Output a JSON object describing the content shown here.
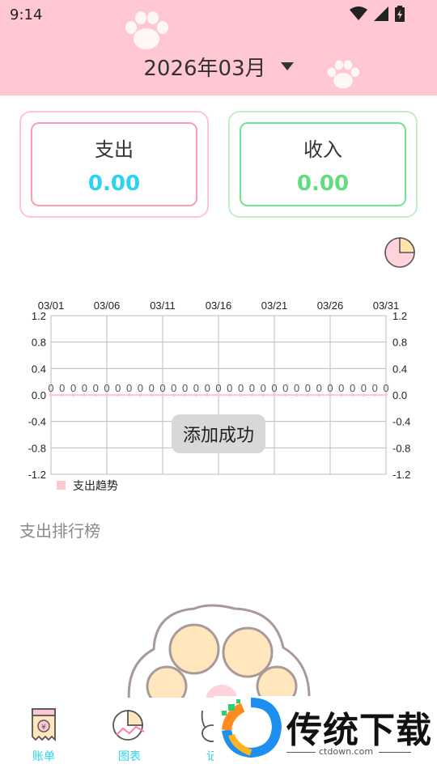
{
  "status_bar": {
    "time": "9:14"
  },
  "header": {
    "month": "2026年03月"
  },
  "summary": {
    "expense": {
      "label": "支出",
      "value": "0.00",
      "color": "#2ad3f2"
    },
    "income": {
      "label": "收入",
      "value": "0.00",
      "color": "#62dd7d"
    }
  },
  "chart_data": {
    "type": "line",
    "x_ticks": [
      "03/01",
      "03/06",
      "03/11",
      "03/16",
      "03/21",
      "03/26",
      "03/31"
    ],
    "x": [
      "03/01",
      "03/02",
      "03/03",
      "03/04",
      "03/05",
      "03/06",
      "03/07",
      "03/08",
      "03/09",
      "03/10",
      "03/11",
      "03/12",
      "03/13",
      "03/14",
      "03/15",
      "03/16",
      "03/17",
      "03/18",
      "03/19",
      "03/20",
      "03/21",
      "03/22",
      "03/23",
      "03/24",
      "03/25",
      "03/26",
      "03/27",
      "03/28",
      "03/29",
      "03/30",
      "03/31"
    ],
    "series": [
      {
        "name": "支出趋势",
        "values": [
          0,
          0,
          0,
          0,
          0,
          0,
          0,
          0,
          0,
          0,
          0,
          0,
          0,
          0,
          0,
          0,
          0,
          0,
          0,
          0,
          0,
          0,
          0,
          0,
          0,
          0,
          0,
          0,
          0,
          0,
          0
        ],
        "color": "#ffc7d2"
      }
    ],
    "value_labels": [
      "0",
      "0",
      "0",
      "0",
      "0",
      "0",
      "0",
      "0",
      "0",
      "0",
      "0",
      "0",
      "0",
      "0",
      "0",
      "0",
      "0",
      "0",
      "0",
      "0",
      "0",
      "0",
      "0",
      "0",
      "0",
      "0",
      "0",
      "0",
      "0",
      "0",
      "0"
    ],
    "y_ticks": [
      "1.2",
      "0.8",
      "0.4",
      "0.0",
      "-0.4",
      "-0.8",
      "-1.2"
    ],
    "ylim": [
      -1.2,
      1.2
    ],
    "grid": true,
    "legend_position": "bottom-left"
  },
  "toast": {
    "text": "添加成功"
  },
  "ranking": {
    "title": "支出排行榜"
  },
  "bottom_nav": [
    {
      "label": "账单",
      "icon": "receipt-icon",
      "color": "#2ad3f2"
    },
    {
      "label": "图表",
      "icon": "pie-chart-icon",
      "color": "#2ad3f2"
    },
    {
      "label": "记",
      "icon": "bunny-icon",
      "color": "#2ad3f2"
    }
  ],
  "watermark": {
    "brand": "传统下载",
    "url": "ctdown.com"
  },
  "colors": {
    "header_bg": "#ffc7d2",
    "accent": "#2ad3f2",
    "income": "#62dd7d"
  }
}
